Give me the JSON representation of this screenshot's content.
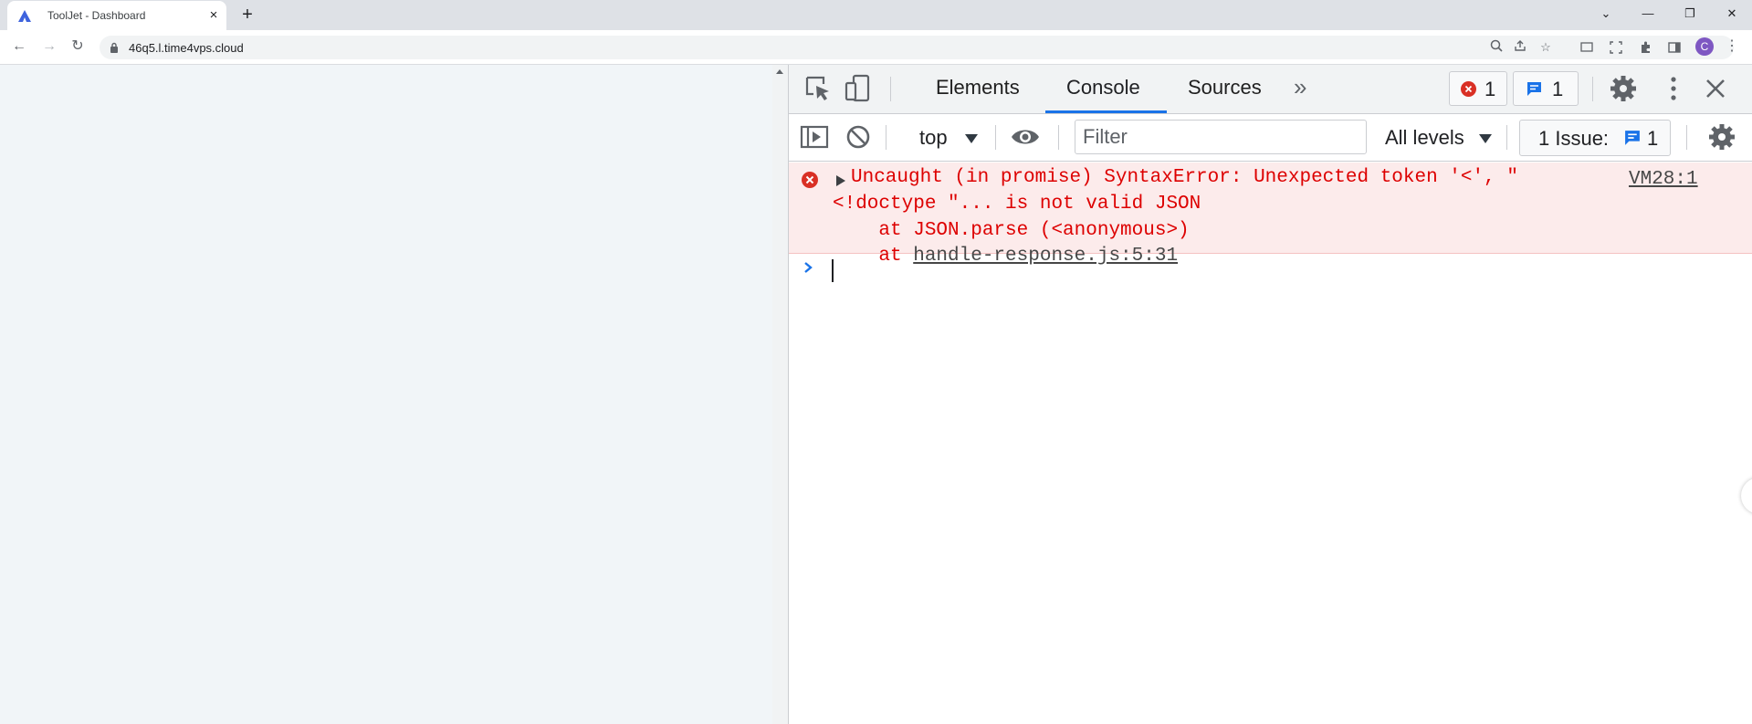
{
  "browser": {
    "tab": {
      "title": "ToolJet - Dashboard",
      "close": "×"
    },
    "new_tab": "+",
    "window_controls": {
      "dropdown": "⌄",
      "minimize": "—",
      "restore": "❐",
      "close": "✕"
    },
    "nav": {
      "back": "←",
      "forward": "→",
      "reload": "↻"
    },
    "url": "46q5.l.time4vps.cloud",
    "profile_initial": "C",
    "menu": "⋮"
  },
  "devtools": {
    "tabs": [
      "Elements",
      "Console",
      "Sources"
    ],
    "more_tabs": "»",
    "active_tab": "Console",
    "error_count": "1",
    "message_count": "1",
    "console_toolbar": {
      "context": "top",
      "filter_placeholder": "Filter",
      "levels": "All levels",
      "issues_label": "1 Issue:",
      "issues_count": "1"
    },
    "messages": [
      {
        "level": "error",
        "line1": "Uncaught (in promise) SyntaxError: Unexpected token '<', \"",
        "line2": "<!doctype \"... is not valid JSON",
        "stack1": "    at JSON.parse (<anonymous>)",
        "stack2_prefix": "    at ",
        "stack2_link": "handle-response.js:5:31",
        "source": "VM28:1"
      }
    ]
  },
  "colors": {
    "accent": "#1a73e8",
    "error_text": "#dd0000",
    "error_bg": "#fcebeb",
    "page_bg": "#f1f5f8"
  }
}
